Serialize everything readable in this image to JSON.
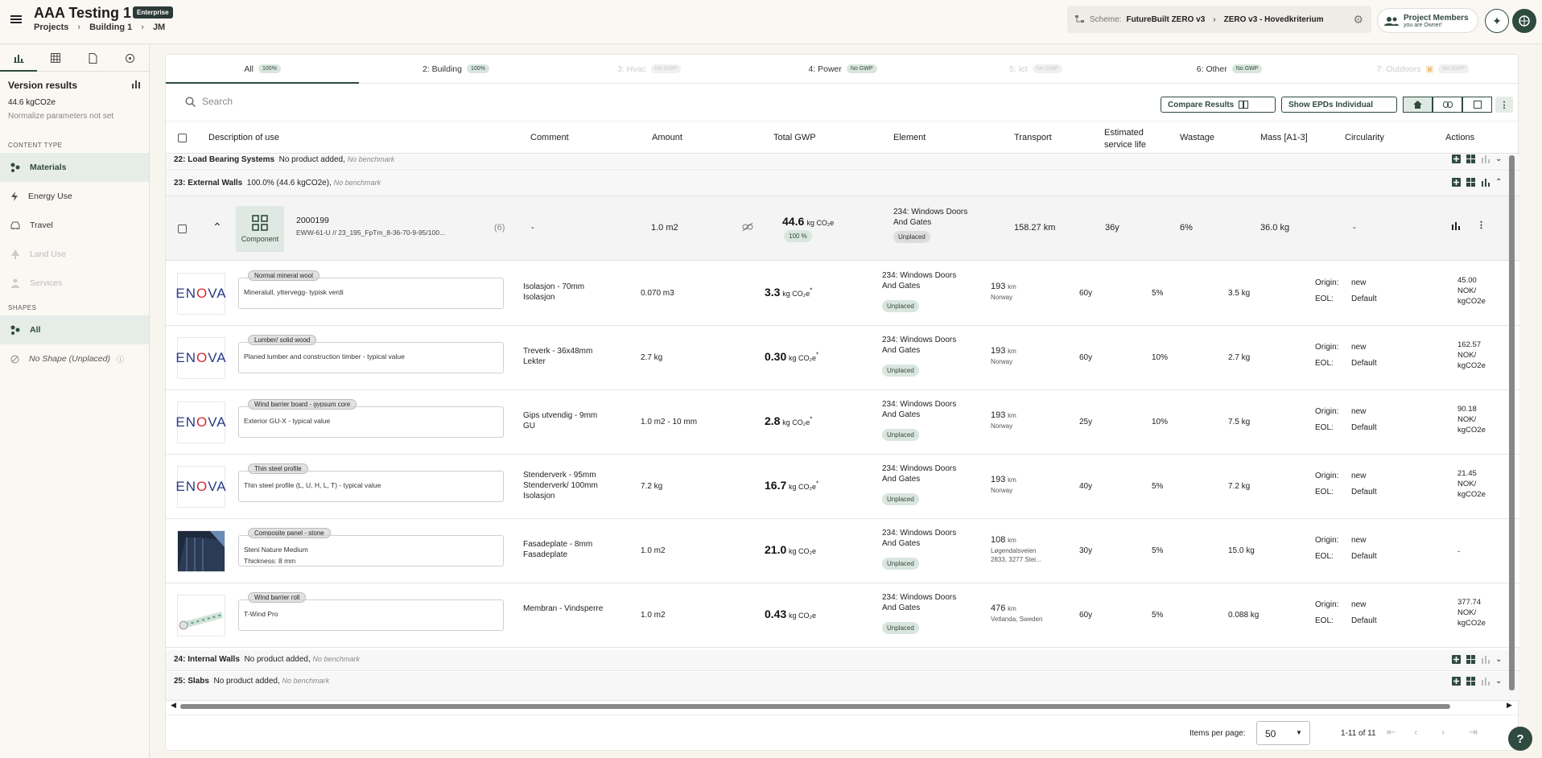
{
  "header": {
    "title": "AAA Testing 1",
    "badge": "Enterprise",
    "breadcrumbs": [
      "Projects",
      "Building 1",
      "JM"
    ],
    "scheme_label": "Scheme:",
    "scheme_value": "FutureBuilt ZERO v3",
    "scheme_criterion": "ZERO v3 - Hovedkriterium",
    "members_label": "Project Members",
    "members_sub": "you are Owner!"
  },
  "sidebar": {
    "version_title": "Version results",
    "version_value": "44.6 kgCO2e",
    "version_note": "Normalize parameters not set",
    "content_type_heading": "CONTENT TYPE",
    "content_items": [
      {
        "label": "Materials",
        "icon": "materials-icon",
        "state": "selected"
      },
      {
        "label": "Energy Use",
        "icon": "bolt-icon",
        "state": "normal"
      },
      {
        "label": "Travel",
        "icon": "car-icon",
        "state": "normal"
      },
      {
        "label": "Land Use",
        "icon": "tree-icon",
        "state": "disabled"
      },
      {
        "label": "Services",
        "icon": "person-icon",
        "state": "disabled"
      }
    ],
    "shapes_heading": "SHAPES",
    "shapes_items": [
      {
        "label": "All",
        "state": "selected"
      },
      {
        "label": "No Shape (Unplaced)",
        "state": "normal"
      }
    ]
  },
  "tabs": [
    {
      "label": "All",
      "badge": "100%",
      "state": "active"
    },
    {
      "label": "2: Building",
      "badge": "100%",
      "state": "normal"
    },
    {
      "label": "3: Hvac",
      "badge": "No GWP",
      "state": "disabled"
    },
    {
      "label": "4: Power",
      "badge": "No GWP",
      "state": "normal"
    },
    {
      "label": "5: Ict",
      "badge": "No GWP",
      "state": "disabled"
    },
    {
      "label": "6: Other",
      "badge": "No GWP",
      "state": "normal"
    },
    {
      "label": "7: Outdoors",
      "badge": "No GWP",
      "state": "disabled"
    }
  ],
  "toolbar": {
    "search_placeholder": "Search",
    "compare_label": "Compare Results",
    "show_epds_label": "Show EPDs Individual"
  },
  "columns": {
    "description": "Description of use",
    "comment": "Comment",
    "amount": "Amount",
    "total_gwp": "Total GWP",
    "element": "Element",
    "transport": "Transport",
    "service_life_1": "Estimated",
    "service_life_2": "service life",
    "wastage": "Wastage",
    "mass": "Mass [A1-3]",
    "circularity": "Circularity",
    "actions": "Actions"
  },
  "groups": {
    "g22": {
      "name": "22: Load Bearing Systems",
      "status": "No product added,",
      "bench": "No benchmark"
    },
    "g23": {
      "name": "23: External Walls",
      "status": "100.0% (44.6 kgCO2e),",
      "bench": "No benchmark"
    },
    "g24": {
      "name": "24: Internal Walls",
      "status": "No product added,",
      "bench": "No benchmark"
    },
    "g25": {
      "name": "25: Slabs",
      "status": "No product added,",
      "bench": "No benchmark"
    }
  },
  "component": {
    "icon_label": "Component",
    "id": "2000199",
    "code": "EWW-61-U // 23_195_FpTm_8-36-70-9-95/100...",
    "count": "(6)",
    "comment": "-",
    "amount": "1.0 m2",
    "gwp_value": "44.6",
    "gwp_unit": "kg CO₂e",
    "gwp_pct": "100 %",
    "element": "234: Windows Doors And Gates",
    "element_status": "Unplaced",
    "transport": "158.27 km",
    "service_life": "36y",
    "wastage": "6%",
    "mass": "36.0 kg",
    "circularity": "-"
  },
  "materials": [
    {
      "tag": "Normal mineral wool",
      "desc1": "Mineralull, yttervegg- typisk verdi",
      "desc2": "",
      "brand": "ENOVA",
      "comment": "Isolasjon - 70mm\nIsolasjon",
      "amount": "0.070 m3",
      "gwp": "3.3",
      "gwp_unit": "kg CO₂e",
      "star": "*",
      "element": "234: Windows Doors And Gates",
      "status": "Unplaced",
      "transport_km": "193",
      "km_unit": "km",
      "transport_loc": "Norway",
      "life": "60y",
      "wastage": "5%",
      "mass": "3.5 kg",
      "origin_label": "Origin:",
      "origin": "new",
      "eol_label": "EOL:",
      "eol": "Default",
      "cost": "45.00\nNOK/\nkgCO2e"
    },
    {
      "tag": "Lumber/ solid wood",
      "desc1": "Planed lumber and construction timber - typical value",
      "desc2": "",
      "brand": "ENOVA",
      "comment": "Treverk - 36x48mm\nLekter",
      "amount": "2.7 kg",
      "gwp": "0.30",
      "gwp_unit": "kg CO₂e",
      "star": "*",
      "element": "234: Windows Doors And Gates",
      "status": "Unplaced",
      "transport_km": "193",
      "km_unit": "km",
      "transport_loc": "Norway",
      "life": "60y",
      "wastage": "10%",
      "mass": "2.7 kg",
      "origin_label": "Origin:",
      "origin": "new",
      "eol_label": "EOL:",
      "eol": "Default",
      "cost": "162.57\nNOK/\nkgCO2e"
    },
    {
      "tag": "Wind barrier board - gypsum core",
      "desc1": "Exterior GU-X - typical value",
      "desc2": "",
      "brand": "ENOVA",
      "comment": "Gips utvendig - 9mm\nGU",
      "amount": "1.0 m2 - 10 mm",
      "gwp": "2.8",
      "gwp_unit": "kg CO₂e",
      "star": "*",
      "element": "234: Windows Doors And Gates",
      "status": "Unplaced",
      "transport_km": "193",
      "km_unit": "km",
      "transport_loc": "Norway",
      "life": "25y",
      "wastage": "10%",
      "mass": "7.5 kg",
      "origin_label": "Origin:",
      "origin": "new",
      "eol_label": "EOL:",
      "eol": "Default",
      "cost": "90.18\nNOK/\nkgCO2e"
    },
    {
      "tag": "Thin steel profile",
      "desc1": "Thin steel profile (L, U, H, L, T) - typical value",
      "desc2": "",
      "brand": "ENOVA",
      "comment": "Stenderverk - 95mm\nStenderverk/ 100mm\nIsolasjon",
      "amount": "7.2 kg",
      "gwp": "16.7",
      "gwp_unit": "kg CO₂e",
      "star": "*",
      "element": "234: Windows Doors And Gates",
      "status": "Unplaced",
      "transport_km": "193",
      "km_unit": "km",
      "transport_loc": "Norway",
      "life": "40y",
      "wastage": "5%",
      "mass": "7.2 kg",
      "origin_label": "Origin:",
      "origin": "new",
      "eol_label": "EOL:",
      "eol": "Default",
      "cost": "21.45\nNOK/\nkgCO2e"
    },
    {
      "tag": "Composite panel - stone",
      "desc1": "Steni Nature Medium",
      "desc2": "Thickness: 8 mm",
      "brand": "photo-building",
      "comment": "Fasadeplate - 8mm\nFasadeplate",
      "amount": "1.0 m2",
      "gwp": "21.0",
      "gwp_unit": "kg CO₂e",
      "star": "",
      "element": "234: Windows Doors And Gates",
      "status": "Unplaced",
      "transport_km": "108",
      "km_unit": "km",
      "transport_loc": "Løgendalsveien\n2833, 3277 Stei...",
      "life": "30y",
      "wastage": "5%",
      "mass": "15.0 kg",
      "origin_label": "Origin:",
      "origin": "new",
      "eol_label": "EOL:",
      "eol": "Default",
      "cost": "-"
    },
    {
      "tag": "Wind barrier roll",
      "desc1": "T-Wind Pro",
      "desc2": "",
      "brand": "photo-roll",
      "comment": "Membran - Vindsperre",
      "amount": "1.0 m2",
      "gwp": "0.43",
      "gwp_unit": "kg CO₂e",
      "star": "",
      "element": "234: Windows Doors And Gates",
      "status": "Unplaced",
      "transport_km": "476",
      "km_unit": "km",
      "transport_loc": "Vetlanda, Sweden",
      "life": "60y",
      "wastage": "5%",
      "mass": "0.088 kg",
      "origin_label": "Origin:",
      "origin": "new",
      "eol_label": "EOL:",
      "eol": "Default",
      "cost": "377.74\nNOK/\nkgCO2e"
    }
  ],
  "pagination": {
    "items_label": "Items per page:",
    "per_page": "50",
    "range": "1-11 of 11"
  },
  "help_label": "?",
  "colors": {
    "accent": "#2f4a3f",
    "accent_light": "#d9e6df",
    "enova_blue": "#273a85",
    "enova_red": "#d42a35"
  }
}
